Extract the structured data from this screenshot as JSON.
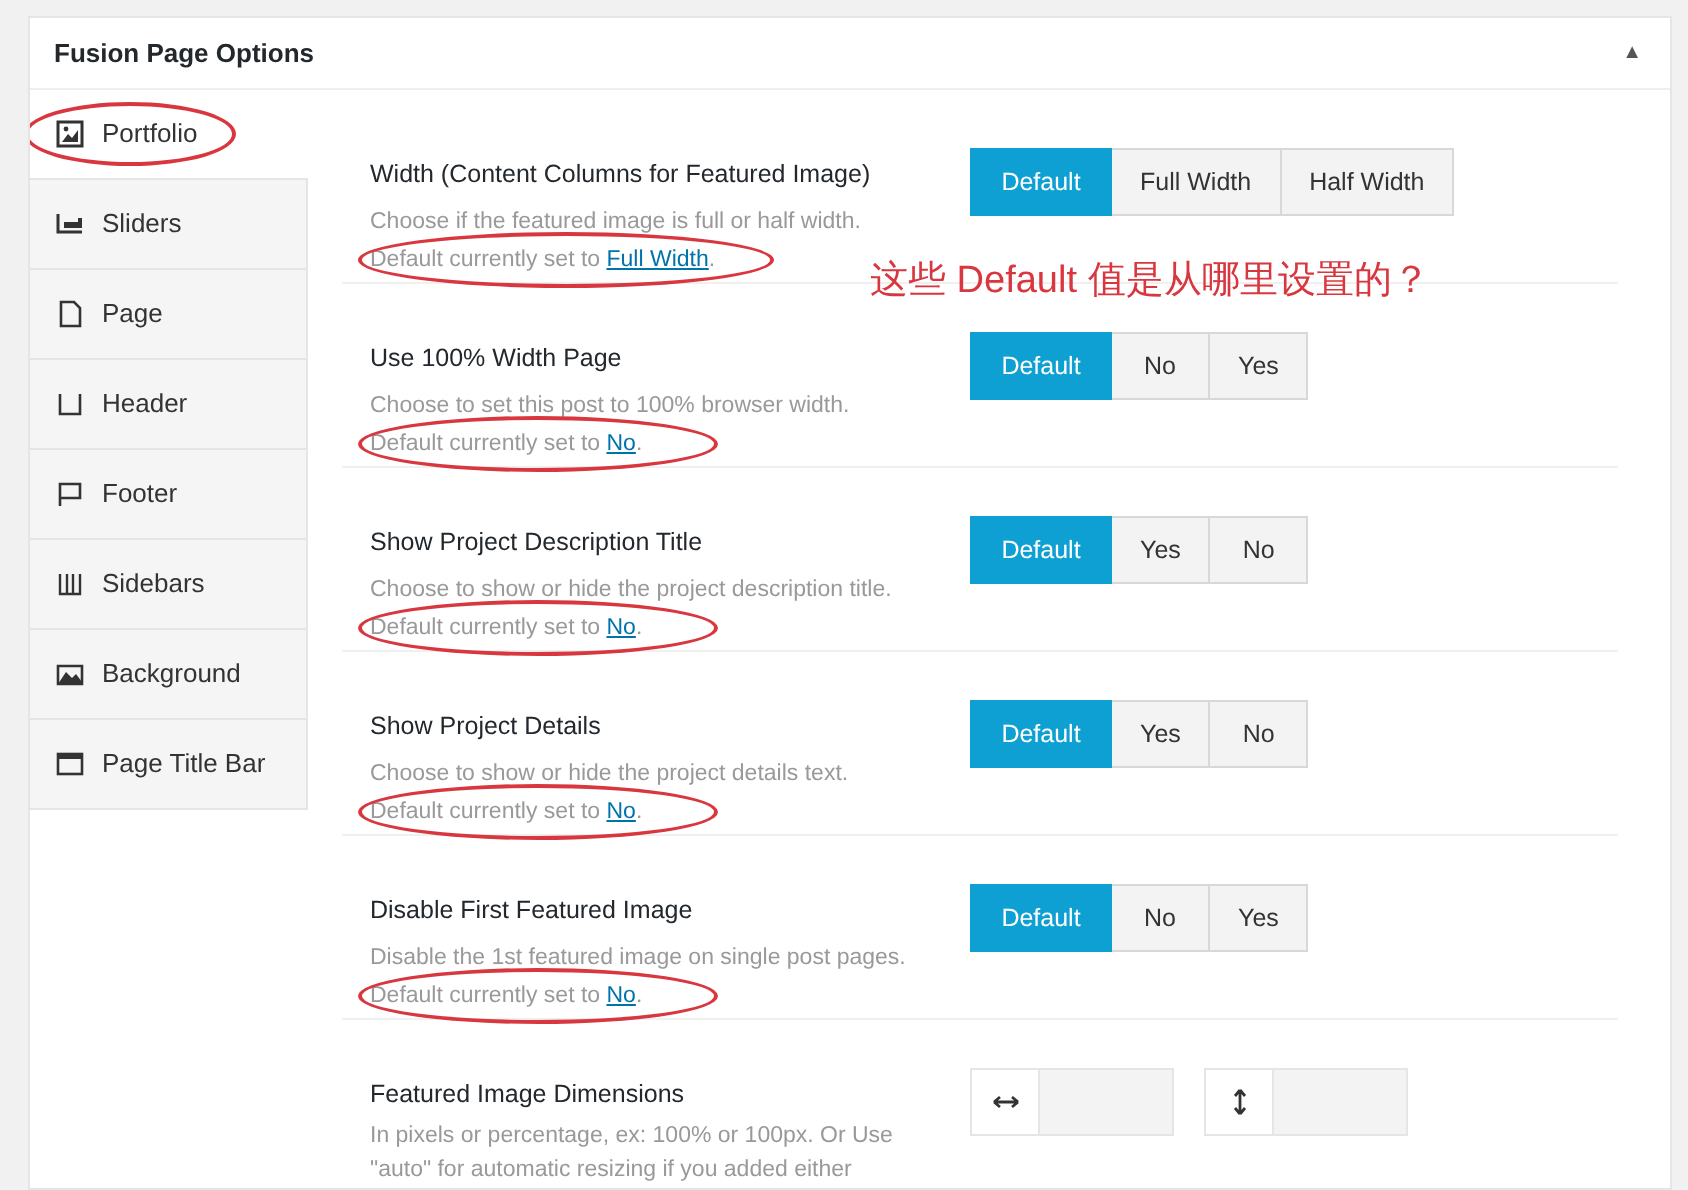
{
  "panel": {
    "title": "Fusion Page Options",
    "toggle": "▲"
  },
  "tabs": [
    {
      "label": "Portfolio",
      "selected": true,
      "circled": true
    },
    {
      "label": "Sliders",
      "selected": false,
      "circled": false
    },
    {
      "label": "Page",
      "selected": false,
      "circled": false
    },
    {
      "label": "Header",
      "selected": false,
      "circled": false
    },
    {
      "label": "Footer",
      "selected": false,
      "circled": false
    },
    {
      "label": "Sidebars",
      "selected": false,
      "circled": false
    },
    {
      "label": "Background",
      "selected": false,
      "circled": false
    },
    {
      "label": "Page Title Bar",
      "selected": false,
      "circled": false
    }
  ],
  "annotation": "这些 Default 值是从哪里设置的？",
  "options": [
    {
      "kind": "buttonset",
      "label": "Width (Content Columns for Featured Image)",
      "description": "Choose if the featured image is full or half width.",
      "default_prefix": "Default currently set to ",
      "default_value": "Full Width",
      "default_suffix": ".",
      "circled": true,
      "buttons": [
        {
          "label": "Default",
          "selected": true
        },
        {
          "label": "Full Width",
          "selected": false
        },
        {
          "label": "Half Width",
          "selected": false
        }
      ]
    },
    {
      "kind": "buttonset",
      "label": "Use 100% Width Page",
      "description": "Choose to set this post to 100% browser width.",
      "default_prefix": "Default currently set to ",
      "default_value": "No",
      "default_suffix": ".",
      "circled": true,
      "buttons": [
        {
          "label": "Default",
          "selected": true
        },
        {
          "label": "No",
          "selected": false
        },
        {
          "label": "Yes",
          "selected": false
        }
      ]
    },
    {
      "kind": "buttonset",
      "label": "Show Project Description Title",
      "description": "Choose to show or hide the project description title.",
      "default_prefix": "Default currently set to ",
      "default_value": "No",
      "default_suffix": ".",
      "circled": true,
      "buttons": [
        {
          "label": "Default",
          "selected": true
        },
        {
          "label": "Yes",
          "selected": false
        },
        {
          "label": "No",
          "selected": false
        }
      ]
    },
    {
      "kind": "buttonset",
      "label": "Show Project Details",
      "description": "Choose to show or hide the project details text.",
      "default_prefix": "Default currently set to ",
      "default_value": "No",
      "default_suffix": ".",
      "circled": true,
      "buttons": [
        {
          "label": "Default",
          "selected": true
        },
        {
          "label": "Yes",
          "selected": false
        },
        {
          "label": "No",
          "selected": false
        }
      ]
    },
    {
      "kind": "buttonset",
      "label": "Disable First Featured Image",
      "description": "Disable the 1st featured image on single post pages.",
      "default_prefix": "Default currently set to ",
      "default_value": "No",
      "default_suffix": ".",
      "circled": true,
      "buttons": [
        {
          "label": "Default",
          "selected": true
        },
        {
          "label": "No",
          "selected": false
        },
        {
          "label": "Yes",
          "selected": false
        }
      ]
    },
    {
      "kind": "dimensions",
      "label": "Featured Image Dimensions",
      "description": "In pixels or percentage, ex: 100% or 100px. Or Use \"auto\" for automatic resizing if you added either"
    }
  ]
}
